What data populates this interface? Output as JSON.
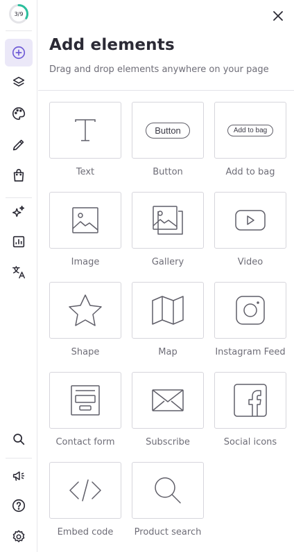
{
  "progress": {
    "label": "3/9",
    "value": 0.333,
    "color": "#2bbf9d"
  },
  "rail": {
    "active_color": "#6f5bd6",
    "items": [
      {
        "name": "add-elements",
        "icon": "plus-circle-icon",
        "active": true
      },
      {
        "name": "layers",
        "icon": "layers-icon"
      },
      {
        "name": "theme",
        "icon": "palette-icon"
      },
      {
        "name": "edit",
        "icon": "pencil-icon"
      },
      {
        "name": "store",
        "icon": "shopping-bag-icon"
      },
      {
        "name": "ai-tools",
        "icon": "sparkles-icon"
      },
      {
        "name": "analytics",
        "icon": "chart-icon"
      },
      {
        "name": "translate",
        "icon": "translate-icon"
      },
      {
        "name": "search",
        "icon": "search-icon"
      },
      {
        "name": "marketing",
        "icon": "megaphone-icon"
      },
      {
        "name": "help",
        "icon": "help-icon"
      },
      {
        "name": "settings",
        "icon": "gear-icon"
      }
    ]
  },
  "panel": {
    "title": "Add elements",
    "subtitle": "Drag and drop elements anywhere on your page",
    "close_icon": "close-icon"
  },
  "elements": [
    {
      "label": "Text",
      "icon": "text-icon"
    },
    {
      "label": "Button",
      "icon": "button-preview",
      "preview_text": "Button"
    },
    {
      "label": "Add to bag",
      "icon": "add-to-bag-preview",
      "preview_text": "Add to bag"
    },
    {
      "label": "Image",
      "icon": "image-icon"
    },
    {
      "label": "Gallery",
      "icon": "gallery-icon"
    },
    {
      "label": "Video",
      "icon": "video-icon"
    },
    {
      "label": "Shape",
      "icon": "star-icon"
    },
    {
      "label": "Map",
      "icon": "map-icon"
    },
    {
      "label": "Instagram Feed",
      "icon": "instagram-icon"
    },
    {
      "label": "Contact form",
      "icon": "form-icon"
    },
    {
      "label": "Subscribe",
      "icon": "envelope-icon"
    },
    {
      "label": "Social icons",
      "icon": "facebook-icon"
    },
    {
      "label": "Embed code",
      "icon": "code-icon"
    },
    {
      "label": "Product search",
      "icon": "search-icon"
    }
  ]
}
